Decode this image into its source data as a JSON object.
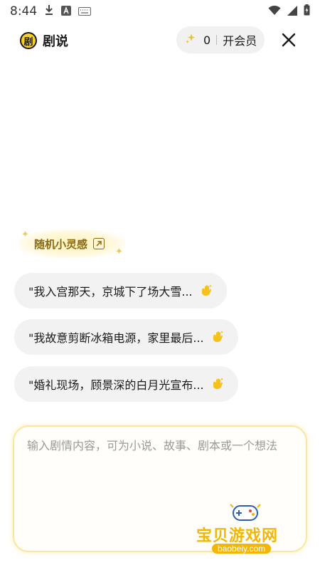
{
  "status_bar": {
    "time": "8:44",
    "icons": [
      "download-icon",
      "a-icon",
      "keyboard-icon",
      "wifi-icon",
      "signal-icon",
      "battery-icon"
    ]
  },
  "header": {
    "brand_name": "剧说",
    "brand_logo_char": "剧",
    "points": "0",
    "vip_label": "开会员"
  },
  "inspiration": {
    "label": "随机小灵感"
  },
  "suggestions": [
    {
      "text": "\"我入宫那天，京城下了场大雪..."
    },
    {
      "text": "\"我故意剪断冰箱电源，家里最后..."
    },
    {
      "text": "\"婚礼现场，顾景深的白月光宣布..."
    }
  ],
  "input": {
    "placeholder": "输入剧情内容，可为小说、故事、剧本或一个想法",
    "value": ""
  },
  "watermark": {
    "title": "宝贝游戏网",
    "subtitle": "baobeiy.com"
  },
  "colors": {
    "accent_yellow": "#f7cf2a",
    "inspire_text": "#8a6a12",
    "chip_bg": "#f2f2f2",
    "input_border": "#fbe69a"
  }
}
